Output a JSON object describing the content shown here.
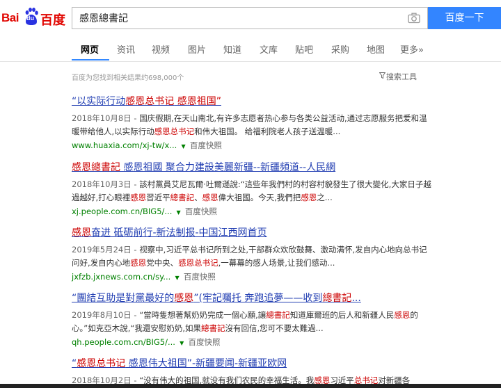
{
  "header": {
    "logo_text_bai": "Bai",
    "logo_text_du": "du",
    "logo_text_cn": "百度",
    "search_value": "感恩總書記",
    "search_button": "百度一下"
  },
  "nav": {
    "items": [
      "网页",
      "资讯",
      "视频",
      "图片",
      "知道",
      "文库",
      "贴吧",
      "采购",
      "地图",
      "更多»"
    ]
  },
  "stats": "百度为您找到相关结果约698,000个",
  "tools_label": "搜索工具",
  "results": [
    {
      "title": [
        "“以实际行动",
        "感恩总书记",
        " 感恩祖国”"
      ],
      "date": "2018年10月8日 - ",
      "abs": [
        "国庆假期,在天山南北,有许多志愿者热心参与各类公益活动,通过志愿服务把爱和温暖带给他人,以实际行动",
        "感恩总书记",
        "和伟大祖国。 给福利院老人孩子送温暖..."
      ],
      "url": "www.huaxia.com/xj-tw/x...",
      "snapshot": "百度快照"
    },
    {
      "title": [
        "感恩總書記",
        " 感恩祖國 聚合力建設美麗新疆--新疆頻道--人民網"
      ],
      "date": "2018年10月3日 - ",
      "abs": [
        "該村黨員艾尼瓦爾·吐爾遜說:“這些年我們村的村容村貌發生了很大變化,大家日子越過越好,打心眼裡",
        "感恩",
        "習近平",
        "總書記",
        "、",
        "感恩",
        "偉大祖國。今天,我們把",
        "感恩",
        "之..."
      ],
      "url": "xj.people.com.cn/BIG5/...",
      "snapshot": "百度快照"
    },
    {
      "title": [
        "感恩",
        "奋进 砥砺前行-新法制报-中国江西网首页"
      ],
      "date": "2019年5月24日 - ",
      "abs": [
        "视察中,习近平总书记所到之处,干部群众欢欣鼓舞、激动满怀,发自内心地向总书记问好,发自内心地",
        "感恩",
        "党中央、",
        "感恩总书记",
        ",一幕幕的感人场景,让我们感动..."
      ],
      "url": "jxfzb.jxnews.com.cn/sy...",
      "snapshot": "百度快照"
    },
    {
      "title": [
        "“團結互助是對黨最好的",
        "感恩",
        "”(牢記囑托 奔跑追夢——收到",
        "總書記",
        "..."
      ],
      "date": "2019年8月10日 - ",
      "abs": [
        "“當時隻想著幫奶奶完成一個心願,讓",
        "總書記",
        "知道庫爾班的后人和新疆人民",
        "感恩",
        "的心。”如克亞木說,“我還安慰奶奶,如果",
        "總書記",
        "沒有回信,您可不要太難過..."
      ],
      "url": "qh.people.com.cn/BIG5/...",
      "snapshot": "百度快照"
    },
    {
      "title": [
        "“",
        "感恩总书记",
        " 感恩伟大祖国”-新疆要闻-新疆亚欧网"
      ],
      "date": "2018年10月2日 - ",
      "abs": [
        "“没有伟大的祖国,就没有我们农民的幸福生活。我",
        "感恩",
        "习近平",
        "总书记",
        "对新疆各"
      ]
    }
  ]
}
